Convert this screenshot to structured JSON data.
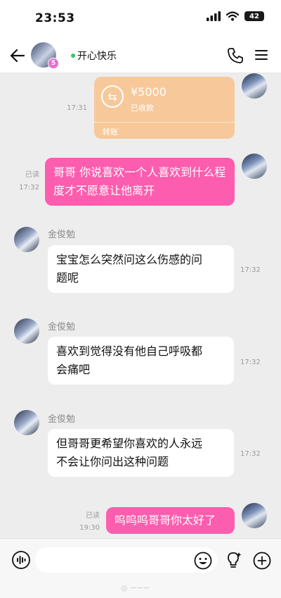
{
  "status_bar": {
    "time": "23:53",
    "battery": "42"
  },
  "header": {
    "contact_name": "开心快乐",
    "vip_level": "5"
  },
  "messages": {
    "transfer": {
      "time": "17:31",
      "amount": "¥5000",
      "status": "已收款",
      "footer": "转账"
    },
    "m1": {
      "read": "已读",
      "time": "17:32",
      "text_line1": "哥哥 你说喜欢一个人喜欢到什么程",
      "text_line2": "度才不愿意让他离开"
    },
    "m2": {
      "sender": "金俊勉",
      "time": "17:32",
      "text_line1": "宝宝怎么突然问这么伤感的问",
      "text_line2": "题呢"
    },
    "m3": {
      "sender": "金俊勉",
      "time": "17:32",
      "text_line1": "喜欢到觉得没有他自己呼吸都",
      "text_line2": "会痛吧"
    },
    "m4": {
      "sender": "金俊勉",
      "time": "17:32",
      "text_line1": "但哥哥更希望你喜欢的人永远",
      "text_line2": "不会让你问出这种问题"
    },
    "m5": {
      "read": "已读",
      "time": "19:30",
      "text": "呜呜呜哥哥你太好了"
    }
  },
  "input_bar": {
    "placeholder": ""
  },
  "colors": {
    "pink_bubble": "#fd5dae",
    "transfer_card": "#f7c99a",
    "background": "#ededed"
  }
}
